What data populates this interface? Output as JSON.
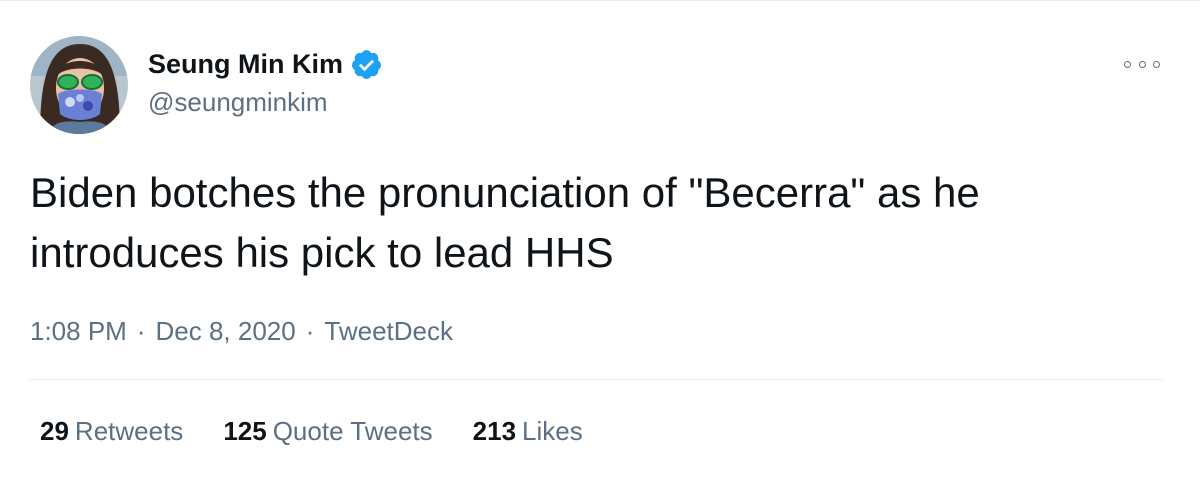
{
  "author": {
    "display_name": "Seung Min Kim",
    "handle": "@seungminkim",
    "verified": true,
    "avatar_icon": "avatar-icon"
  },
  "tweet": {
    "text": "Biden botches the pronunciation of \"Becerra\" as he\nintroduces his pick to lead HHS"
  },
  "meta": {
    "time": "1:08 PM",
    "separator": "·",
    "date": "Dec 8, 2020",
    "source": "TweetDeck"
  },
  "stats": {
    "retweets": {
      "count": "29",
      "label": "Retweets"
    },
    "quote_tweets": {
      "count": "125",
      "label": "Quote Tweets"
    },
    "likes": {
      "count": "213",
      "label": "Likes"
    }
  },
  "colors": {
    "text_primary": "#0f1419",
    "text_secondary": "#5b7083",
    "verified_blue": "#1da1f2",
    "divider": "#e6ecf0"
  }
}
